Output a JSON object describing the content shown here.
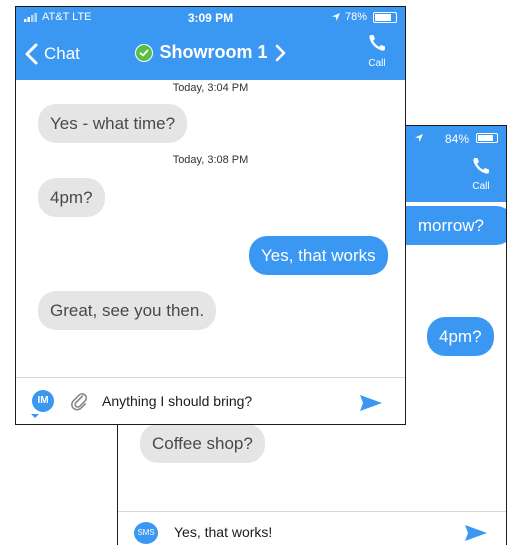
{
  "back_phone": {
    "status": {
      "battery_percent": "84%",
      "location_icon": "location-arrow-icon",
      "battery_icon": "battery-icon"
    },
    "header": {
      "call_label": "Call",
      "call_icon": "phone-icon"
    },
    "messages": [
      {
        "direction": "out",
        "text": "morrow?"
      },
      {
        "direction": "out",
        "text": "4pm?"
      },
      {
        "direction": "in",
        "text": "Coffee shop?"
      }
    ],
    "input": {
      "channel_badge": "SMS",
      "value": "Yes, that works!",
      "send_icon": "send-icon"
    }
  },
  "front_phone": {
    "status": {
      "carrier": "AT&T  LTE",
      "time": "3:09 PM",
      "battery_percent": "78%",
      "location_icon": "location-arrow-icon",
      "battery_icon": "battery-icon",
      "signal_icon": "signal-bars-icon"
    },
    "header": {
      "back_label": "Chat",
      "title": "Showroom 1",
      "call_label": "Call",
      "verified_icon": "check-circle-icon",
      "chevron_icon": "chevron-right-icon"
    },
    "timestamps": [
      "Today, 3:04 PM",
      "Today, 3:08 PM"
    ],
    "messages": [
      {
        "direction": "in",
        "text": "Yes - what time?"
      },
      {
        "direction": "in",
        "text": "4pm?"
      },
      {
        "direction": "out",
        "text": "Yes, that works"
      },
      {
        "direction": "in",
        "text": "Great, see you then."
      }
    ],
    "input": {
      "channel_badge": "IM",
      "value": "Anything I should bring?",
      "attach_icon": "paperclip-icon",
      "send_icon": "send-icon"
    }
  },
  "colors": {
    "accent": "#3b98f2",
    "incoming_bubble": "#e5e5e5",
    "verified": "#58c04a"
  }
}
